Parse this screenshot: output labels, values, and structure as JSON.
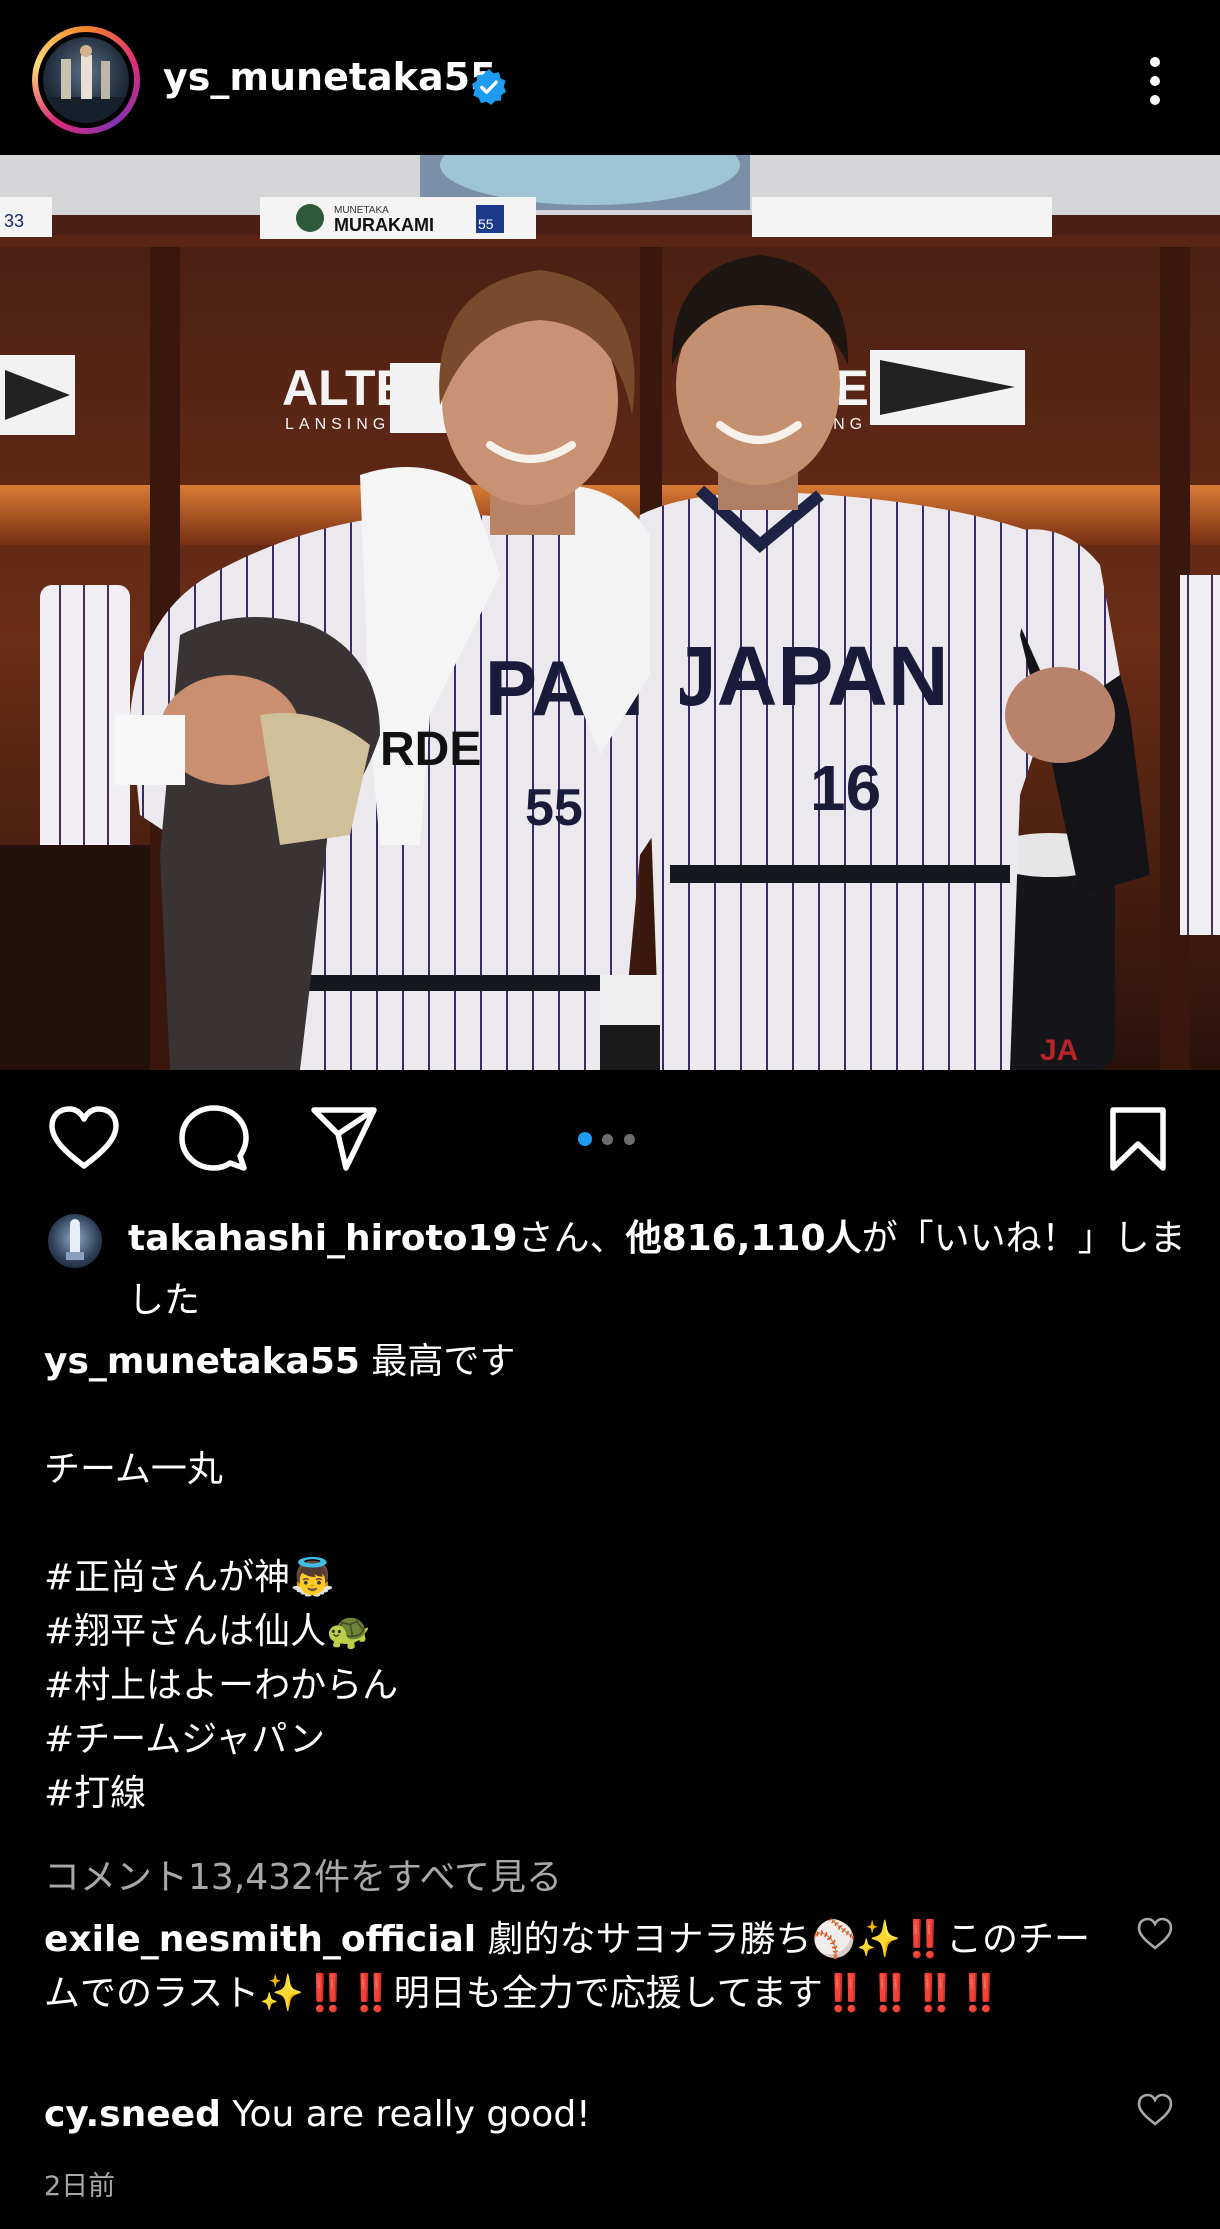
{
  "post": {
    "username": "ys_munetaka55",
    "verified": true
  },
  "photo": {
    "nameplate_small": "MUNETAKA",
    "nameplate_name": "MURAKAMI",
    "nameplate_number": "55",
    "left_number": "33",
    "brand_left": "ALTEC",
    "brand_left_sub": "LANSING",
    "brand_right": "TEC",
    "brand_right_sub": "SING",
    "jersey_right": "JAPAN",
    "jersey_right_number": "16",
    "jersey_left": "PAN",
    "jersey_left_number": "55",
    "towel_text": "RDE",
    "bag_text": "JA",
    "carousel_dots": 3,
    "active_dot": 0
  },
  "actions": {
    "like_icon": "heart-icon",
    "comment_icon": "comment-icon",
    "share_icon": "send-icon",
    "save_icon": "bookmark-icon"
  },
  "likes": {
    "liker": "takahashi_hiroto19",
    "mid": "さん、",
    "others": "他816,110人",
    "suffix": "が「いいね！」しました"
  },
  "caption": {
    "username": "ys_munetaka55",
    "line1": "最高です",
    "line2": "チーム一丸",
    "tag1": "#正尚さんが神👼",
    "tag2": "#翔平さんは仙人🐢",
    "tag3": "#村上はよーわからん",
    "tag4": "#チームジャパン",
    "tag5": "#打線"
  },
  "view_all_comments": "コメント13,432件をすべて見る",
  "comments": [
    {
      "username": "exile_nesmith_official",
      "text": "劇的なサヨナラ勝ち⚾✨‼️このチームでのラスト✨‼️‼️明日も全力で応援してます‼️‼️‼️‼️"
    },
    {
      "username": "cy.sneed",
      "text": "You are really good!"
    }
  ],
  "timestamp": "2日前",
  "colors": {
    "background": "#000000",
    "text": "#ffffff",
    "muted": "#a8a8a8",
    "verified": "#1d9bf0",
    "active_dot": "#1d9bf0"
  }
}
